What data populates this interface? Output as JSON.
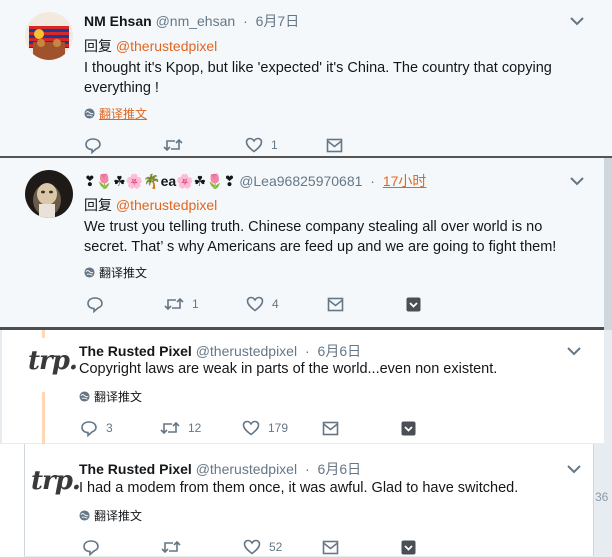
{
  "reply_prefix": "回复",
  "translate_label": "翻译推文",
  "tweets": [
    {
      "name": "NM Ehsan",
      "handle": "@nm_ehsan",
      "time": "6月7日",
      "reply_to": "@therustedpixel",
      "text": "I thought it's Kpop, but like 'expected' it's China.  The country that copying everything !",
      "replies": "",
      "retweets": "",
      "likes": "1"
    },
    {
      "name": "❣🌷☘🌸🌴ea🌸☘🌷❣",
      "handle": "@Lea96825970681",
      "time": "17小时",
      "reply_to": "@therustedpixel",
      "text": "We trust you telling truth. Chinese company stealing all over world is no secret. That’ s why Americans are feed up and we are going to fight them!",
      "replies": "",
      "retweets": "1",
      "likes": "4"
    },
    {
      "name": "The Rusted Pixel",
      "handle": "@therustedpixel",
      "time": "6月6日",
      "text": "Copyright laws are weak in parts of the world...even non existent.",
      "replies": "3",
      "retweets": "12",
      "likes": "179"
    },
    {
      "name": "The Rusted Pixel",
      "handle": "@therustedpixel",
      "time": "6月6日",
      "text": "I had a modem from them once, it was awful. Glad to have switched.",
      "replies": "",
      "retweets": "",
      "likes": "52"
    }
  ],
  "avatar_logo_text": "trp.",
  "edge_fragment": "36",
  "colors": {
    "link": "#e0661f",
    "muted": "#657786",
    "thread_line": "#ffd7b5"
  }
}
